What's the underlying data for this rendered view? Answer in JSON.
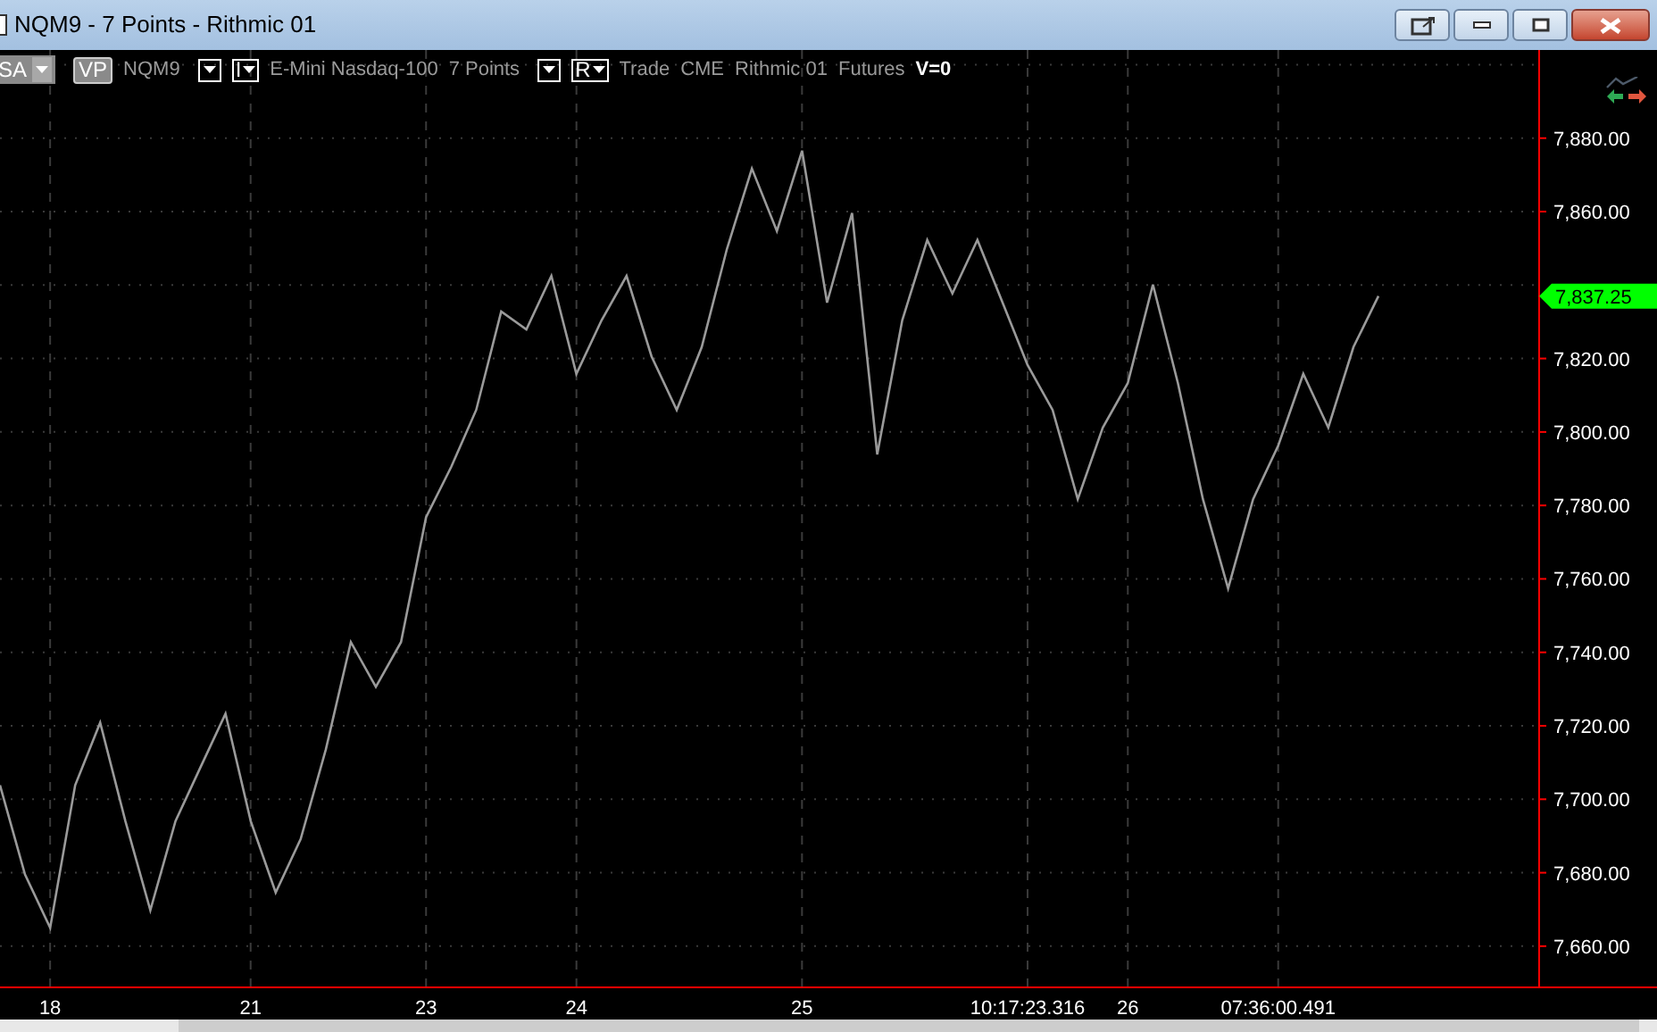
{
  "window": {
    "title": "NQM9 - 7 Points - Rithmic 01"
  },
  "toolbar": [
    {
      "kind": "dropdown",
      "label": "SA"
    },
    {
      "kind": "tag",
      "label": "VP"
    },
    {
      "kind": "text",
      "label": "NQM9"
    },
    {
      "kind": "dropdown"
    },
    {
      "kind": "menu",
      "label": "I"
    },
    {
      "kind": "text",
      "label": "E-Mini Nasdaq-100"
    },
    {
      "kind": "text",
      "label": "7 Points"
    },
    {
      "kind": "dropdown"
    },
    {
      "kind": "menu",
      "label": "R"
    },
    {
      "kind": "text",
      "label": "Trade"
    },
    {
      "kind": "text",
      "label": "CME"
    },
    {
      "kind": "text",
      "label": "Rithmic 01"
    },
    {
      "kind": "text",
      "label": "Futures"
    },
    {
      "kind": "strong",
      "label": "V=0"
    }
  ],
  "price_tag": "7,837.25",
  "chart_data": {
    "type": "line",
    "grid": true,
    "ylim": [
      7650,
      7904
    ],
    "categories": [
      null,
      null,
      "18",
      null,
      null,
      null,
      null,
      null,
      null,
      null,
      "21",
      null,
      null,
      null,
      null,
      null,
      null,
      "23",
      null,
      null,
      null,
      null,
      null,
      "24",
      null,
      null,
      null,
      null,
      null,
      null,
      null,
      null,
      "25",
      null,
      null,
      null,
      null,
      null,
      null,
      null,
      null,
      "10:17:23.316",
      null,
      null,
      null,
      "26",
      null,
      null,
      null,
      null,
      null,
      "07:36:00.491",
      null,
      null,
      null,
      null
    ],
    "series": [
      {
        "color": "#9a9a9a",
        "values": [
          7703.8,
          7679.5,
          7665,
          7703.8,
          7720.9,
          7694.1,
          7669.8,
          7694.1,
          7708.7,
          7723.3,
          7694.1,
          7674.6,
          7689.2,
          7713.6,
          7742.8,
          7730.6,
          7742.8,
          7776.8,
          7790.5,
          7806,
          7832.8,
          7827.9,
          7842.5,
          7815.8,
          7830.4,
          7842.5,
          7820.6,
          7806,
          7823.1,
          7849.8,
          7871.7,
          7854.7,
          7876.6,
          7835.2,
          7859.6,
          7793.9,
          7830.4,
          7852.3,
          7837.7,
          7852.3,
          7835.2,
          7818.2,
          7806,
          7781.7,
          7801.2,
          7813.3,
          7840.1,
          7813.3,
          7781.7,
          7757.4,
          7781.7,
          7796.3,
          7815.8,
          7801.2,
          7823.1,
          7837
        ]
      }
    ],
    "yticks": [
      {
        "value": 7660,
        "label": "7,660.00"
      },
      {
        "value": 7680,
        "label": "7,680.00"
      },
      {
        "value": 7700,
        "label": "7,700.00"
      },
      {
        "value": 7720,
        "label": "7,720.00"
      },
      {
        "value": 7740,
        "label": "7,740.00"
      },
      {
        "value": 7760,
        "label": "7,760.00"
      },
      {
        "value": 7780,
        "label": "7,780.00"
      },
      {
        "value": 7800,
        "label": "7,800.00"
      },
      {
        "value": 7820,
        "label": "7,820.00"
      },
      {
        "value": 7860,
        "label": "7,860.00"
      },
      {
        "value": 7880,
        "label": "7,880.00"
      }
    ]
  }
}
